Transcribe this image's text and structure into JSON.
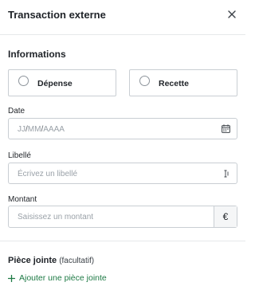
{
  "header": {
    "title": "Transaction externe",
    "close_icon": "close-icon"
  },
  "informations": {
    "title": "Informations"
  },
  "type": {
    "options": [
      {
        "label": "Dépense",
        "selected": false
      },
      {
        "label": "Recette",
        "selected": false
      }
    ]
  },
  "date": {
    "label": "Date",
    "placeholder_dd": "JJ",
    "placeholder_mm": "MM",
    "placeholder_yyyy": "AAAA",
    "sep": "/",
    "icon": "calendar-icon"
  },
  "libelle": {
    "label": "Libellé",
    "placeholder": "Écrivez un libellé",
    "icon": "text-cursor-icon"
  },
  "montant": {
    "label": "Montant",
    "placeholder": "Saisissez un montant",
    "currency": "€"
  },
  "attachment": {
    "title": "Pièce jointe",
    "optional": "(facultatif)",
    "add_label": "Ajouter une pièce jointe",
    "icon": "plus-icon"
  },
  "colors": {
    "accent_green": "#1e7a45",
    "border": "#c9ced3",
    "placeholder": "#9aa1a8"
  }
}
